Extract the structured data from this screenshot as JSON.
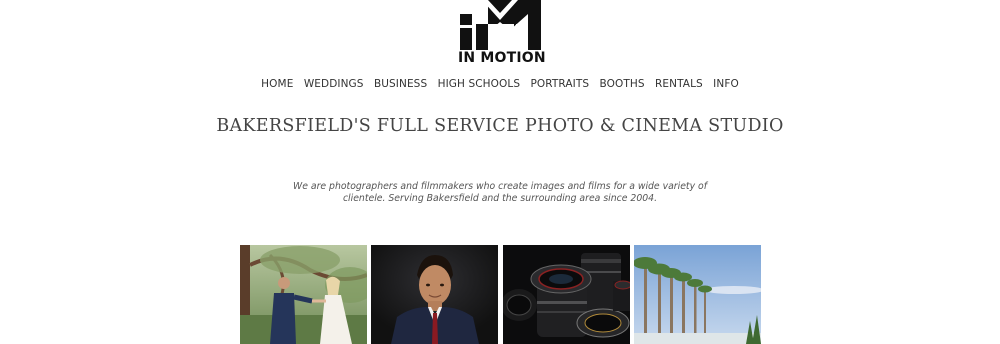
{
  "logo": {
    "icon": "im-monogram-icon",
    "text": "IN MOTION"
  },
  "nav": {
    "items": [
      {
        "label": "HOME"
      },
      {
        "label": "WEDDINGS"
      },
      {
        "label": "BUSINESS"
      },
      {
        "label": "HIGH SCHOOLS"
      },
      {
        "label": "PORTRAITS"
      },
      {
        "label": "BOOTHS"
      },
      {
        "label": "RENTALS"
      },
      {
        "label": "INFO"
      }
    ]
  },
  "hero": {
    "headline": "BAKERSFIELD'S FULL SERVICE PHOTO & CINEMA STUDIO",
    "intro": "We are photographers and filmmakers who create images and films for a wide variety of clientele.  Serving Bakersfield and the surrounding area since 2004."
  },
  "gallery": {
    "tiles": [
      {
        "subject": "wedding-couple-photo"
      },
      {
        "subject": "senior-portrait-photo"
      },
      {
        "subject": "camera-lenses-photo"
      },
      {
        "subject": "palm-trees-photo"
      }
    ]
  },
  "colors": {
    "background": "#ffffff",
    "logo": "#111111",
    "nav_text": "#333333",
    "headline_text": "#444444",
    "intro_text": "#555555"
  }
}
